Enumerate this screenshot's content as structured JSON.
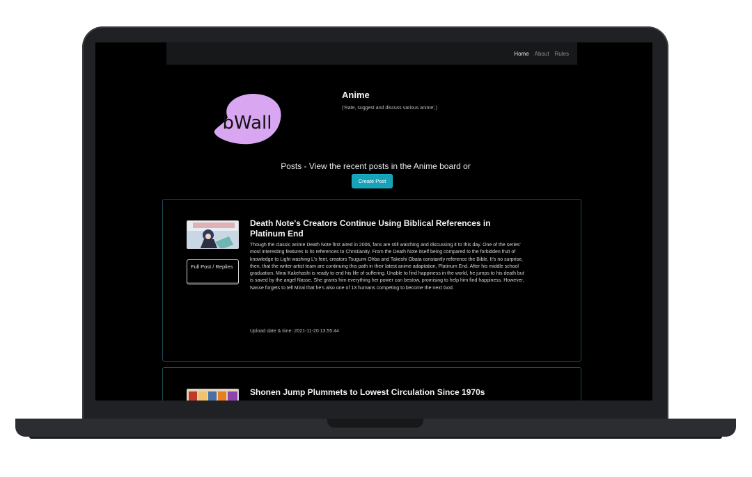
{
  "nav": {
    "links": [
      "Home",
      "About",
      "Rules"
    ]
  },
  "logo": {
    "text": "bWall",
    "color": "#d9a6f2"
  },
  "board": {
    "title": "Anime",
    "description": "('Rate, suggest and discuss various anime',)"
  },
  "posts_section": {
    "heading": "Posts - View the recent posts in the Anime board or",
    "create_button": "Create Post"
  },
  "posts": [
    {
      "title": "Death Note's Creators Continue Using Biblical References in Platinum End",
      "body": "Though the classic anime Death Note first aired in 2006, fans are still watching and discussing it to this day. One of the series' most interesting features is its references to Christianity. From the Death Note itself being compared to the forbidden fruit of knowledge to Light washing L's feet, creators Tsugumi Ohba and Takeshi Obata constantly reference the Bible. It's no surprise, then, that the writer-artist team are continuing this path in their latest anime adaptation, Platinum End. After his middle school graduation, Mirai Kakehashi is ready to end his life of suffering. Unable to find happiness in the world, he jumps to his death but is saved by the angel Nasse. She grants him everything her power can bestow, promising to help him find happiness. However, Nasse forgets to tell Mirai that he's also one of 13 humans competing to become the next God.",
      "meta": "Upload date & time: 2021-11-20 13:55:44",
      "button": "Full Post / Replies"
    },
    {
      "title": "Shonen Jump Plummets to Lowest Circulation Since 1970s"
    }
  ],
  "colors": {
    "accent": "#17a2b8",
    "card_border": "#1f4a52",
    "background": "#000000"
  }
}
